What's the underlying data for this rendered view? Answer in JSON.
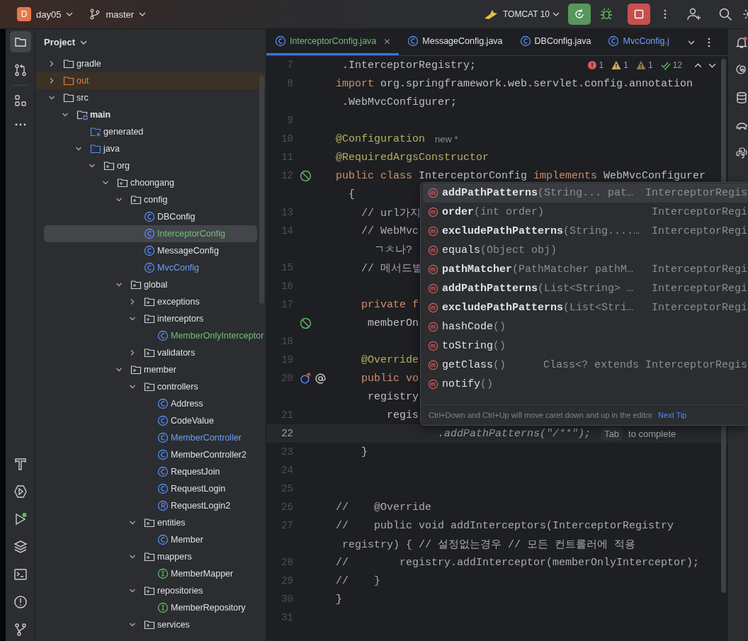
{
  "title_bar": {
    "project_badge": "D",
    "project": "day05",
    "branch": "master",
    "run_config": "TOMCAT 10"
  },
  "project_panel": {
    "title": "Project",
    "tree": [
      {
        "name": "gradle",
        "kind": "folder",
        "expanded": false,
        "excluded": false,
        "color": "#dfe1e5",
        "selected": false
      },
      {
        "name": "out",
        "kind": "folder",
        "expanded": false,
        "excluded": true,
        "color": "#d9834f",
        "selected": false
      },
      {
        "name": "src",
        "kind": "folder",
        "expanded": true,
        "excluded": false,
        "color": "#dfe1e5",
        "selected": false,
        "children": [
          {
            "name": "main",
            "kind": "module",
            "expanded": true,
            "color": "#dfe1e5",
            "selected": false,
            "children": [
              {
                "name": "generated",
                "kind": "generated",
                "color": "#dfe1e5",
                "selected": false
              },
              {
                "name": "java",
                "kind": "source",
                "expanded": true,
                "color": "#dfe1e5",
                "selected": false,
                "children": [
                  {
                    "name": "org",
                    "kind": "package",
                    "expanded": true,
                    "color": "#dfe1e5",
                    "selected": false,
                    "children": [
                      {
                        "name": "choongang",
                        "kind": "package",
                        "expanded": true,
                        "color": "#dfe1e5",
                        "selected": false,
                        "children": [
                          {
                            "name": "config",
                            "kind": "package",
                            "expanded": true,
                            "color": "#dfe1e5",
                            "selected": false,
                            "children": [
                              {
                                "name": "DBConfig",
                                "kind": "class",
                                "color": "#dfe1e5",
                                "selected": false
                              },
                              {
                                "name": "InterceptorConfig",
                                "kind": "class",
                                "color": "#73bd79",
                                "selected": true
                              },
                              {
                                "name": "MessageConfig",
                                "kind": "class",
                                "color": "#dfe1e5",
                                "selected": false
                              },
                              {
                                "name": "MvcConfig",
                                "kind": "class",
                                "color": "#6f9ff8",
                                "selected": false
                              }
                            ]
                          },
                          {
                            "name": "global",
                            "kind": "package",
                            "expanded": true,
                            "color": "#dfe1e5",
                            "selected": false,
                            "children": [
                              {
                                "name": "exceptions",
                                "kind": "package",
                                "expanded": false,
                                "color": "#dfe1e5",
                                "selected": false
                              },
                              {
                                "name": "interceptors",
                                "kind": "package",
                                "expanded": true,
                                "color": "#dfe1e5",
                                "selected": false,
                                "children": [
                                  {
                                    "name": "MemberOnlyInterceptor",
                                    "kind": "class",
                                    "color": "#73bd79",
                                    "selected": false
                                  }
                                ]
                              },
                              {
                                "name": "validators",
                                "kind": "package",
                                "expanded": false,
                                "color": "#dfe1e5",
                                "selected": false
                              }
                            ]
                          },
                          {
                            "name": "member",
                            "kind": "package",
                            "expanded": true,
                            "color": "#dfe1e5",
                            "selected": false,
                            "children": [
                              {
                                "name": "controllers",
                                "kind": "package",
                                "expanded": true,
                                "color": "#dfe1e5",
                                "selected": false,
                                "children": [
                                  {
                                    "name": "Address",
                                    "kind": "class",
                                    "color": "#dfe1e5",
                                    "selected": false
                                  },
                                  {
                                    "name": "CodeValue",
                                    "kind": "class",
                                    "color": "#dfe1e5",
                                    "selected": false
                                  },
                                  {
                                    "name": "MemberController",
                                    "kind": "class",
                                    "color": "#6f9ff8",
                                    "selected": false
                                  },
                                  {
                                    "name": "MemberController2",
                                    "kind": "class",
                                    "color": "#dfe1e5",
                                    "selected": false
                                  },
                                  {
                                    "name": "RequestJoin",
                                    "kind": "class",
                                    "color": "#dfe1e5",
                                    "selected": false
                                  },
                                  {
                                    "name": "RequestLogin",
                                    "kind": "class",
                                    "color": "#dfe1e5",
                                    "selected": false
                                  },
                                  {
                                    "name": "RequestLogin2",
                                    "kind": "record",
                                    "color": "#dfe1e5",
                                    "selected": false
                                  }
                                ]
                              },
                              {
                                "name": "entities",
                                "kind": "package",
                                "expanded": true,
                                "color": "#dfe1e5",
                                "selected": false,
                                "children": [
                                  {
                                    "name": "Member",
                                    "kind": "class",
                                    "color": "#dfe1e5",
                                    "selected": false
                                  }
                                ]
                              },
                              {
                                "name": "mappers",
                                "kind": "package",
                                "expanded": true,
                                "color": "#dfe1e5",
                                "selected": false,
                                "children": [
                                  {
                                    "name": "MemberMapper",
                                    "kind": "interface",
                                    "color": "#dfe1e5",
                                    "selected": false
                                  }
                                ]
                              },
                              {
                                "name": "repositories",
                                "kind": "package",
                                "expanded": true,
                                "color": "#dfe1e5",
                                "selected": false,
                                "children": [
                                  {
                                    "name": "MemberRepository",
                                    "kind": "interface",
                                    "color": "#dfe1e5",
                                    "selected": false
                                  }
                                ]
                              },
                              {
                                "name": "services",
                                "kind": "package",
                                "expanded": true,
                                "color": "#dfe1e5",
                                "selected": false
                              }
                            ]
                          }
                        ]
                      }
                    ]
                  }
                ]
              }
            ]
          }
        ]
      }
    ]
  },
  "tabs": [
    {
      "label": "InterceptorConfig.java",
      "color": "#73bd79",
      "selected": true
    },
    {
      "label": "MessageConfig.java",
      "color": "#dfe1e5",
      "selected": false
    },
    {
      "label": "DBConfig.java",
      "color": "#dfe1e5",
      "selected": false
    },
    {
      "label": "MvcConfig.j",
      "color": "#6f9ff8",
      "selected": false
    }
  ],
  "inspections": {
    "errors": "1",
    "warnings": "1",
    "weak_warnings": "1",
    "passed": "12"
  },
  "editor": {
    "rows": [
      {
        "num": "7",
        "current": false,
        "code": [
          {
            "t": " .InterceptorRegistry;",
            "kind": "plain"
          }
        ]
      },
      {
        "num": "8",
        "current": false,
        "code": [
          {
            "t": "import",
            "kind": "keyword"
          },
          {
            "t": " org.springframework.web.servlet.config.annotation",
            "kind": "plain"
          }
        ]
      },
      {
        "current": false,
        "code": [
          {
            "t": " .WebMvcConfigurer;",
            "kind": "plain"
          }
        ]
      },
      {
        "num": "9",
        "current": false
      },
      {
        "num": "10",
        "current": false,
        "code": [
          {
            "t": "@Configuration",
            "kind": "annotation"
          }
        ],
        "hints": [
          {
            "text": "new *",
            "kind": "author"
          }
        ]
      },
      {
        "num": "11",
        "current": false,
        "code": [
          {
            "t": "@RequiredArgsConstructor",
            "kind": "annotation"
          }
        ]
      },
      {
        "num": "12",
        "current": false,
        "markers": [
          {
            "kind": "bean"
          }
        ],
        "code": [
          {
            "t": "public class",
            "kind": "keyword"
          },
          {
            "t": " InterceptorConfig ",
            "kind": "plain"
          },
          {
            "t": "implements",
            "kind": "keyword"
          },
          {
            "t": " WebMvcConfigurer",
            "kind": "plain"
          }
        ]
      },
      {
        "current": false,
        "code": [
          {
            "t": "  {",
            "kind": "plain"
          }
        ]
      },
      {
        "num": "13",
        "current": false,
        "code": [
          {
            "t": "    // url가지",
            "kind": "comment"
          }
        ]
      },
      {
        "num": "14",
        "current": false,
        "code": [
          {
            "t": "    // WebMvc",
            "kind": "comment"
          }
        ]
      },
      {
        "current": false,
        "code": [
          {
            "t": "      ㄱㅊ나?",
            "kind": "comment"
          }
        ]
      },
      {
        "num": "15",
        "current": false,
        "code": [
          {
            "t": "    // 메서드별",
            "kind": "comment"
          }
        ]
      },
      {
        "num": "16",
        "current": false
      },
      {
        "num": "17",
        "current": false,
        "code": [
          {
            "t": "    private f",
            "kind": "keyword"
          }
        ]
      },
      {
        "current": false,
        "markers": [
          {
            "kind": "bean"
          }
        ],
        "code": [
          {
            "t": "     memberOn",
            "kind": "plain"
          }
        ]
      },
      {
        "num": "18",
        "current": false
      },
      {
        "num": "19",
        "current": false,
        "code": [
          {
            "t": "    @Override",
            "kind": "annotation"
          }
        ]
      },
      {
        "num": "20",
        "current": false,
        "markers": [
          {
            "kind": "implements"
          },
          {
            "kind": "annotation"
          }
        ],
        "code": [
          {
            "t": "    public vo",
            "kind": "keyword"
          }
        ]
      },
      {
        "current": false,
        "code": [
          {
            "t": "     registry",
            "kind": "plain"
          }
        ]
      },
      {
        "num": "21",
        "current": false,
        "code": [
          {
            "t": "        regis",
            "kind": "plain"
          }
        ]
      },
      {
        "num": "22",
        "current": true,
        "code": [
          {
            "t": "                .addPathPatterns(\"/**\");",
            "kind": "ghost"
          }
        ],
        "hints": [
          {
            "text": "Tab",
            "kind": "key"
          },
          {
            "text": "to complete",
            "kind": "text"
          }
        ]
      },
      {
        "num": "23",
        "current": false,
        "code": [
          {
            "t": "    }",
            "kind": "plain"
          }
        ]
      },
      {
        "num": "24",
        "current": false
      },
      {
        "num": "25",
        "current": false
      },
      {
        "num": "26",
        "current": false,
        "code": [
          {
            "t": "//    @Override",
            "kind": "comment"
          }
        ]
      },
      {
        "num": "27",
        "current": false,
        "code": [
          {
            "t": "//    public void addInterceptors(InterceptorRegistry",
            "kind": "comment"
          }
        ]
      },
      {
        "current": false,
        "code": [
          {
            "t": " registry) { // 설정없는경우 // 모든 컨트롤러에 적용",
            "kind": "comment"
          }
        ]
      },
      {
        "num": "28",
        "current": false,
        "code": [
          {
            "t": "//        registry.addInterceptor(memberOnlyInterceptor);",
            "kind": "comment"
          }
        ]
      },
      {
        "num": "29",
        "current": false,
        "code": [
          {
            "t": "//    }",
            "kind": "comment"
          }
        ]
      },
      {
        "num": "30",
        "current": false,
        "code": [
          {
            "t": "}",
            "kind": "plain"
          }
        ]
      },
      {
        "num": "31",
        "current": false
      }
    ]
  },
  "completion": {
    "items": [
      {
        "name": "addPathPatterns",
        "params": "(String... pat…",
        "type": "InterceptorRegis",
        "inherited": false,
        "selected": true
      },
      {
        "name": "order",
        "params": "(int order)",
        "type": "InterceptorRegi",
        "inherited": false,
        "selected": false
      },
      {
        "name": "excludePathPatterns",
        "params": "(String....…",
        "type": "InterceptorRegi",
        "inherited": false,
        "selected": false
      },
      {
        "name": "equals",
        "params": "(Object obj)",
        "inherited": true,
        "selected": false
      },
      {
        "name": "pathMatcher",
        "params": "(PathMatcher pathM…",
        "type": "InterceptorRegi",
        "inherited": false,
        "selected": false
      },
      {
        "name": "addPathPatterns",
        "params": "(List<String> …",
        "type": "InterceptorRegi",
        "inherited": false,
        "selected": false
      },
      {
        "name": "excludePathPatterns",
        "params": "(List<Stri…",
        "type": "InterceptorRegi",
        "inherited": false,
        "selected": false
      },
      {
        "name": "hashCode",
        "params": "()",
        "inherited": true,
        "selected": false
      },
      {
        "name": "toString",
        "params": "()",
        "inherited": true,
        "selected": false
      },
      {
        "name": "getClass",
        "params": "()",
        "type": "Class<? extends InterceptorRegis",
        "inherited": true,
        "selected": false
      },
      {
        "name": "notify",
        "params": "()",
        "inherited": true,
        "selected": false
      }
    ],
    "tip": "Ctrl+Down and Ctrl+Up will move caret down and up in the editor",
    "next_tip": "Next Tip"
  }
}
